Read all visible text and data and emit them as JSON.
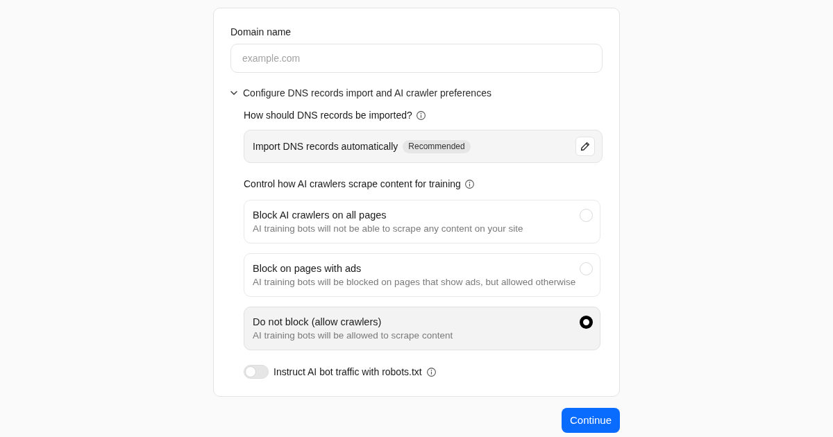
{
  "domain_field": {
    "label": "Domain name",
    "placeholder": "example.com"
  },
  "disclosure": {
    "label": "Configure DNS records import and AI crawler preferences",
    "expanded": true
  },
  "dns_import": {
    "question": "How should DNS records be imported?",
    "method": "Import DNS records automatically",
    "badge": "Recommended"
  },
  "crawler_control": {
    "question": "Control how AI crawlers scrape content for training",
    "options": [
      {
        "title": "Block AI crawlers on all pages",
        "description": "AI training bots will not be able to scrape any content on your site",
        "selected": false
      },
      {
        "title": "Block on pages with ads",
        "description": "AI training bots will be blocked on pages that show ads, but allowed otherwise",
        "selected": false
      },
      {
        "title": "Do not block (allow crawlers)",
        "description": "AI training bots will be allowed to scrape content",
        "selected": true
      }
    ]
  },
  "robots_toggle": {
    "label": "Instruct AI bot traffic with robots.txt",
    "on": false
  },
  "continue_button": {
    "label": "Continue"
  }
}
